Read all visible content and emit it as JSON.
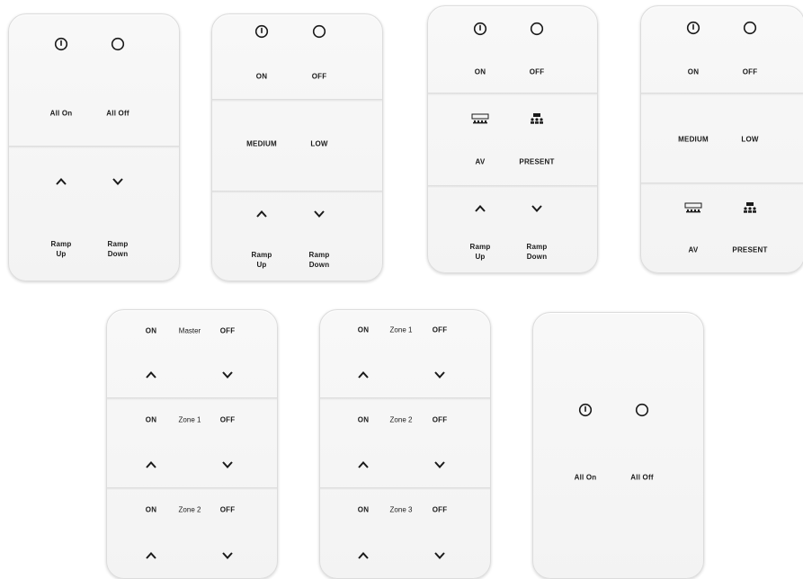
{
  "labels": {
    "on": "ON",
    "off": "OFF",
    "all_on": "All On",
    "all_off": "All Off",
    "medium": "MEDIUM",
    "low": "LOW",
    "av": "AV",
    "present": "PRESENT",
    "ramp": "Ramp",
    "up": "Up",
    "down": "Down",
    "master": "Master",
    "zone1": "Zone 1",
    "zone2": "Zone 2",
    "zone3": "Zone 3"
  },
  "icons": [
    "power-icon",
    "off-circle-icon",
    "chevron-up-icon",
    "chevron-down-icon",
    "av-screen-icon",
    "present-people-icon"
  ],
  "colors": {
    "plate": "#f5f5f5",
    "edge": "#dcdcdc",
    "text": "#1a1a1a"
  }
}
